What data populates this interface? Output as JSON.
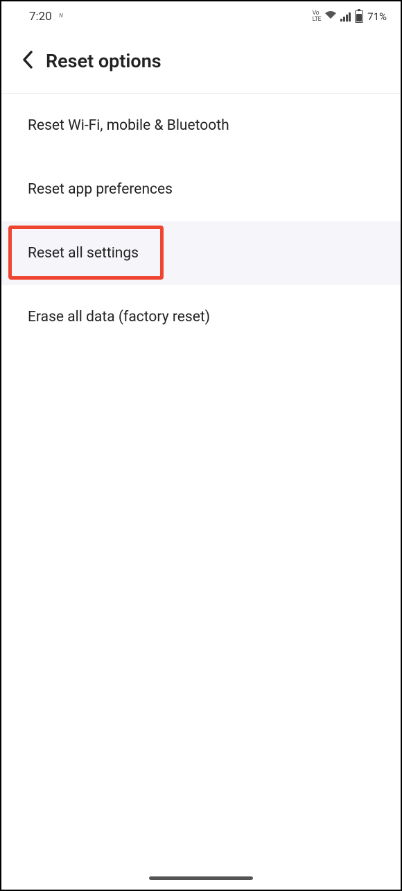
{
  "status": {
    "time": "7:20",
    "nv": "ᴺ",
    "lte": "VoLTE",
    "battery_pct": "71%"
  },
  "header": {
    "title": "Reset options"
  },
  "options": {
    "items": [
      {
        "label": "Reset Wi-Fi, mobile & Bluetooth"
      },
      {
        "label": "Reset app preferences"
      },
      {
        "label": "Reset all settings"
      },
      {
        "label": "Erase all data (factory reset)"
      }
    ]
  }
}
